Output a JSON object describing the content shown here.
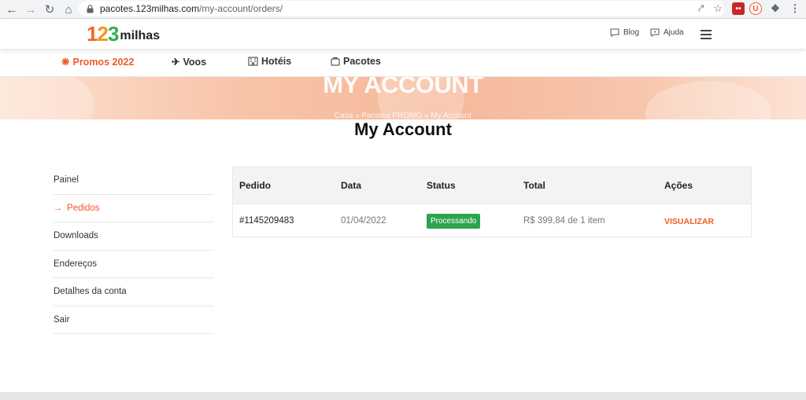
{
  "browser": {
    "url_domain": "pacotes.123milhas.com",
    "url_path": "/my-account/orders/",
    "ext_user_initial": "U"
  },
  "header": {
    "logo_digits": [
      "1",
      "2",
      "3"
    ],
    "logo_word": "milhas",
    "blog_label": "Blog",
    "help_label": "Ajuda"
  },
  "nav": {
    "items": [
      {
        "label": "Promos 2022",
        "icon": "gear-icon"
      },
      {
        "label": "Voos",
        "icon": "plane-icon"
      },
      {
        "label": "Hotéis",
        "icon": "hotel-icon"
      },
      {
        "label": "Pacotes",
        "icon": "suitcase-icon"
      }
    ]
  },
  "banner": {
    "title": "MY ACCOUNT",
    "breadcrumb": "Casa  »  Pacotes PROMO  »  My Account"
  },
  "page": {
    "title": "My Account"
  },
  "sidebar": {
    "items": [
      {
        "label": "Painel"
      },
      {
        "label": "Pedidos",
        "active": true
      },
      {
        "label": "Downloads"
      },
      {
        "label": "Endereços"
      },
      {
        "label": "Detalhes da conta"
      },
      {
        "label": "Sair"
      }
    ]
  },
  "orders": {
    "headers": [
      "Pedido",
      "Data",
      "Status",
      "Total",
      "Ações"
    ],
    "rows": [
      {
        "order": "#1145209483",
        "date": "01/04/2022",
        "status": "Processando",
        "total": "R$ 399,84 de 1 item",
        "action": "VISUALIZAR"
      }
    ]
  },
  "colors": {
    "accent": "#f15a24",
    "status_processing": "#2ea44f"
  }
}
